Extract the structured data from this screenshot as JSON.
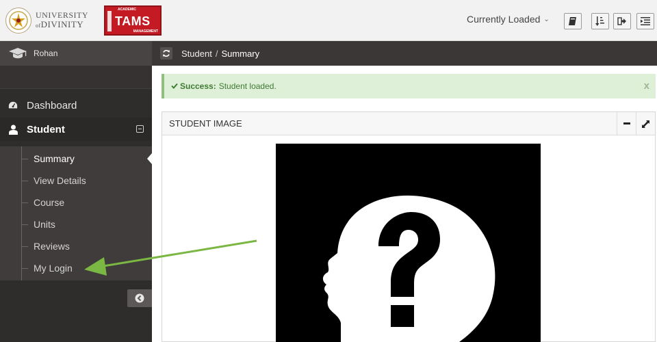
{
  "header": {
    "univ_line1": "UNIVERSITY",
    "univ_line2": "DIVINITY",
    "univ_of": "of",
    "tams_label": "TAMS",
    "tams_top": "ACADEMIC",
    "tams_bottom": "MANAGEMENT",
    "currently_loaded": "Currently Loaded",
    "tools": [
      "book-icon",
      "sort-icon",
      "sign-out-icon",
      "menu-indent-icon"
    ]
  },
  "sidebar": {
    "user_name": "Rohan",
    "items": [
      {
        "label": "Dashboard",
        "icon": "tachometer-icon"
      },
      {
        "label": "Student",
        "icon": "user-icon"
      }
    ],
    "sub_items": [
      {
        "label": "Summary"
      },
      {
        "label": "View Details"
      },
      {
        "label": "Course"
      },
      {
        "label": "Units"
      },
      {
        "label": "Reviews"
      },
      {
        "label": "My Login"
      }
    ]
  },
  "breadcrumb": {
    "parent": "Student",
    "separator": "/",
    "current": "Summary"
  },
  "alert": {
    "title": "Success:",
    "message": "Student loaded.",
    "close": "x"
  },
  "panel": {
    "title": "STUDENT IMAGE"
  },
  "colors": {
    "sidebar_bg": "#2f2d2c",
    "alert_bg": "#dff0d8",
    "annotation_arrow": "#7ab743",
    "brand_red": "#c41a24"
  }
}
